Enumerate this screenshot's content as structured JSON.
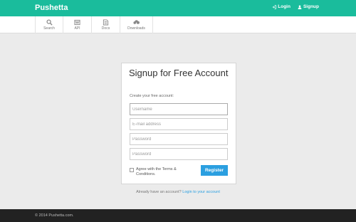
{
  "header": {
    "brand": "Pushetta",
    "login_label": "Login",
    "signup_label": "Signup"
  },
  "subnav": {
    "items": [
      {
        "label": "Search",
        "icon": "search-icon"
      },
      {
        "label": "API",
        "icon": "api-icon"
      },
      {
        "label": "Docs",
        "icon": "docs-icon"
      },
      {
        "label": "Downloads",
        "icon": "cloud-download-icon"
      }
    ]
  },
  "signup": {
    "title": "Signup for Free Account",
    "subtitle": "Create your free account:",
    "username_placeholder": "Username",
    "email_placeholder": "E-mail address",
    "password_placeholder": "Password",
    "password_confirm_placeholder": "Password",
    "agree_text": "Agree with the Terms & Conditions.",
    "register_label": "Register"
  },
  "login_prompt": {
    "text": "Already have an account?",
    "link": "Login to your account"
  },
  "footer": {
    "copyright": "© 2014 Pushetta.com."
  },
  "colors": {
    "accent": "#1abc9c",
    "button": "#2b9fe0",
    "footer": "#222222"
  }
}
